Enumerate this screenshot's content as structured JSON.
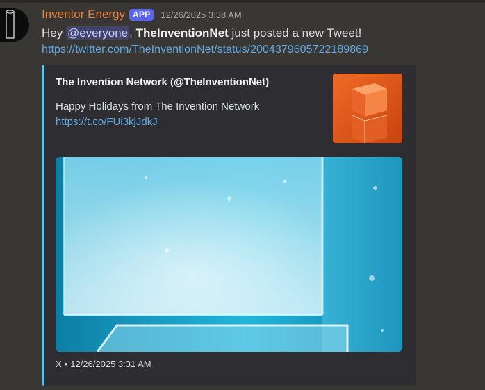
{
  "message": {
    "author": "Inventor Energy",
    "badge": "APP",
    "timestamp": "12/26/2025 3:38 AM",
    "text_prefix": "Hey ",
    "mention": "@everyone",
    "text_comma": ",",
    "bold_name": "TheInventionNet",
    "text_suffix": " just posted a new Tweet!",
    "link": "https://twitter.com/TheInventionNet/status/2004379605722189869"
  },
  "embed": {
    "accent_color": "#5ec4ee",
    "title": "The Invention Network (@TheInventionNet)",
    "description": "Happy Holidays from The Invention Network",
    "link": "https://t.co/FUi3kjJdkJ",
    "footer_source": "X",
    "footer_separator": "•",
    "footer_time": "12/26/2025 3:31 AM"
  },
  "colors": {
    "author": "#f0803c",
    "badge": "#5865f2",
    "link": "#5fa9e6",
    "background": "#393733"
  },
  "icons": {
    "avatar": "inventor-energy-battery-logo",
    "thumbnail": "orange-cube-image",
    "image": "ice-cube-photo"
  }
}
